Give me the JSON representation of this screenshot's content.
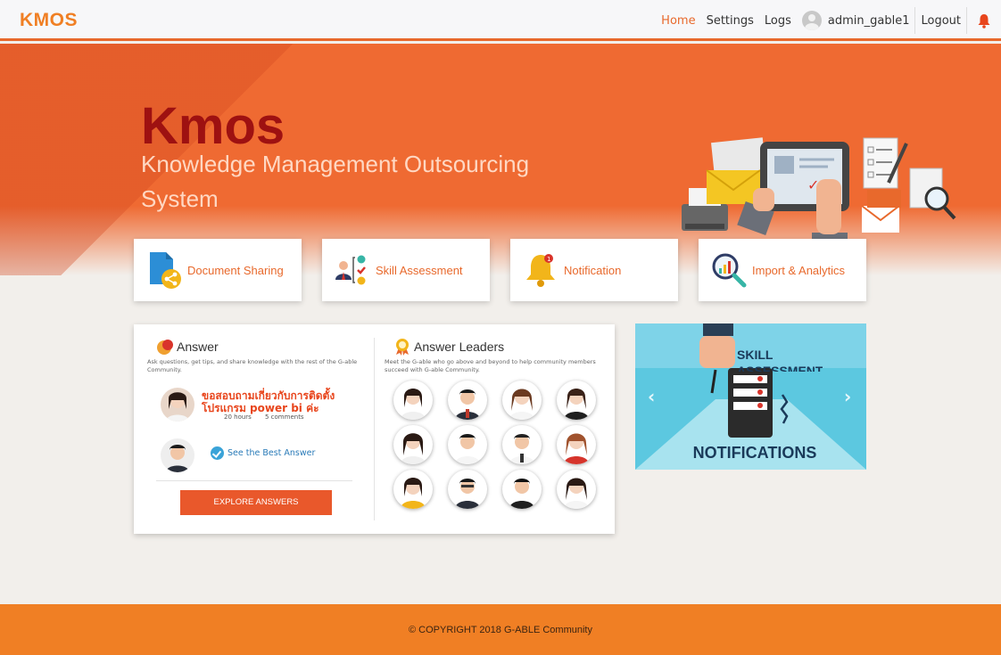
{
  "brand": "KMOS",
  "nav": {
    "home": "Home",
    "settings": "Settings",
    "logs": "Logs",
    "username": "admin_gable1",
    "logout": "Logout"
  },
  "hero": {
    "title": "Kmos",
    "subtitle": "Knowledge Management Outsourcing System"
  },
  "features": [
    {
      "label": "Document Sharing",
      "icon": "document-share-icon"
    },
    {
      "label": "Skill Assessment",
      "icon": "skill-assessment-icon"
    },
    {
      "label": "Notification",
      "icon": "bell-notification-icon"
    },
    {
      "label": "Import & Analytics",
      "icon": "analytics-magnifier-icon"
    }
  ],
  "answer": {
    "title": "Answer",
    "description": "Ask questions, get tips, and share knowledge with the rest of the G-able Community.",
    "question": "ขอสอบถามเกี่ยวกับการติดตั้งโปรแกรม power bi ค่ะ",
    "time": "20 hours",
    "comments": "5 comments",
    "best_answer": "See the Best Answer",
    "explore": "EXPLORE ANSWERS"
  },
  "leaders": {
    "title": "Answer Leaders",
    "description": "Meet the G-able who go above and beyond to help community members succeed with G-able Community."
  },
  "carousel": {
    "skill": "SKILL",
    "assessment": "ASSESSMENT",
    "notifications": "NOTIFICATIONS",
    "prev": "‹",
    "next": "›"
  },
  "footer": "© COPYRIGHT 2018 G-ABLE Community",
  "colors": {
    "brand": "#f07f24",
    "hero": "#ef6a32",
    "title": "#9e1111",
    "button": "#e9582b"
  }
}
